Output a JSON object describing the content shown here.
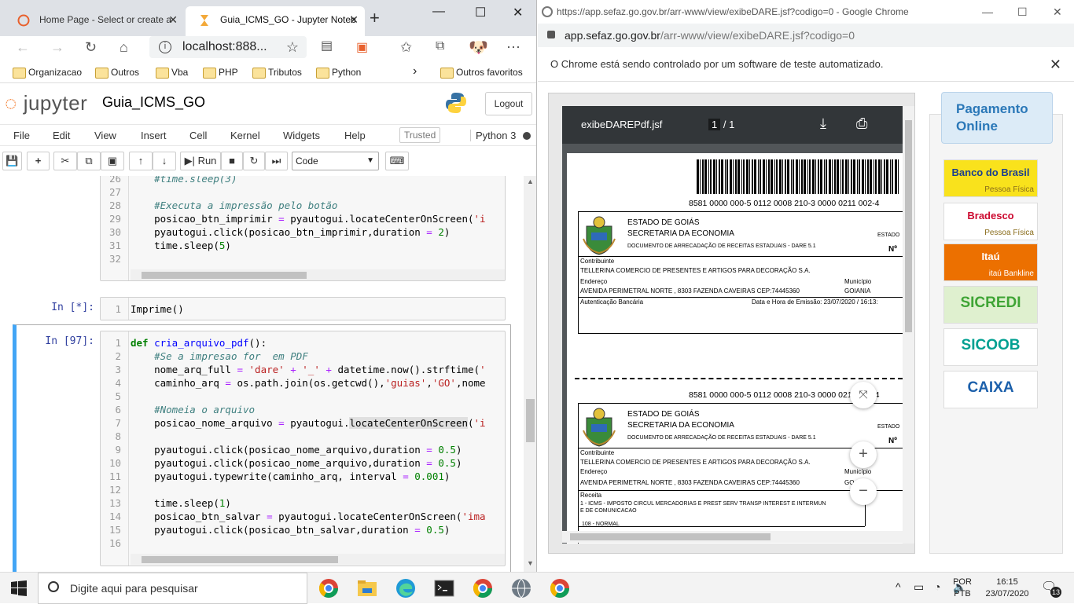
{
  "edge": {
    "tabs": [
      {
        "label": "Home Page - Select or create a"
      },
      {
        "label": "Guia_ICMS_GO - Jupyter Noteb"
      }
    ],
    "address": "localhost:888...",
    "favorites": [
      "Organizacao",
      "Outros",
      "Vba",
      "PHP",
      "Tributos",
      "Python"
    ],
    "other_favorites": "Outros favoritos"
  },
  "jupyter": {
    "logo": "jupyter",
    "notebook_name": "Guia_ICMS_GO",
    "logout": "Logout",
    "menu": [
      "File",
      "Edit",
      "View",
      "Insert",
      "Cell",
      "Kernel",
      "Widgets",
      "Help"
    ],
    "trusted": "Trusted",
    "kernel": "Python 3",
    "run_label": "Run",
    "cell_type": "Code",
    "cells": [
      {
        "prompt": "",
        "line_start": 26,
        "lines": [
          "    #time.sleep(3)",
          "",
          "    #Executa a impressão pelo botão",
          "    posicao_btn_imprimir = pyautogui.locateCenterOnScreen('i",
          "    pyautogui.click(posicao_btn_imprimir,duration = 2)",
          "    time.sleep(5)",
          ""
        ]
      },
      {
        "prompt": "In [*]:",
        "line_start": 1,
        "lines": [
          "Imprime()"
        ]
      },
      {
        "prompt": "In [97]:",
        "line_start": 1,
        "lines": [
          "def cria_arquivo_pdf():",
          "    #Se a impresao for  em PDF",
          "    nome_arq_full = 'dare' + '_' + datetime.now().strftime('",
          "    caminho_arq = os.path.join(os.getcwd(),'guias','GO',nome",
          "",
          "    #Nomeia o arquivo",
          "    posicao_nome_arquivo = pyautogui.locateCenterOnScreen('i",
          "",
          "    pyautogui.click(posicao_nome_arquivo,duration = 0.5)",
          "    pyautogui.click(posicao_nome_arquivo,duration = 0.5)",
          "    pyautogui.typewrite(caminho_arq, interval = 0.001)",
          "",
          "    time.sleep(1)",
          "    posicao_btn_salvar = pyautogui.locateCenterOnScreen('ima",
          "    pyautogui.click(posicao_btn_salvar,duration = 0.5)",
          ""
        ]
      }
    ]
  },
  "chrome": {
    "title": "https://app.sefaz.go.gov.br/arr-www/view/exibeDARE.jsf?codigo=0 - Google Chrome",
    "address_host": "app.sefaz.go.gov.br",
    "address_path": "/arr-www/view/exibeDARE.jsf?codigo=0",
    "infobar": "O Chrome está sendo controlado por um software de teste automatizado.",
    "pdf": {
      "filename": "exibeDAREPdf.jsf",
      "page_current": "1",
      "page_total": "/ 1",
      "barcode_number": "8581 0000 000-5  0112 0008 210-3  0000 0211 002-4",
      "state": "ESTADO DE GOIÁS",
      "secretaria": "SECRETARIA DA ECONOMIA",
      "doc_title": "DOCUMENTO DE ARRECADAÇÃO DE RECEITAS ESTADUAIS - DARE 5.1",
      "estado_label": "ESTADO",
      "no_label": "Nº",
      "contribuinte_label": "Contribuinte",
      "contribuinte": "TELLERINA COMERCIO DE PRESENTES E ARTIGOS PARA DECORAÇÃO S.A.",
      "endereco_label": "Endereço",
      "municipio_label": "Município",
      "endereco": "AVENIDA PERIMETRAL NORTE , 8303 FAZENDA CAVEIRAS  CEP:74445360",
      "municipio": "GOIANIA",
      "municipio_cut": "GO",
      "autenticacao": "Autenticação Bancária",
      "emissao": "Data e Hora de Emissão: 23/07/2020 / 16:13:",
      "receita_label": "Receita",
      "receita": "1 - ICMS - IMPOSTO CIRCUL MERCADORIAS E PREST SERV TRANSP INTEREST E INTERMUN",
      "receita2": "E DE COMUNICACAO",
      "receita_code": "108 - NORMAL"
    },
    "payment_title": "Pagamento Online",
    "banks": [
      {
        "name": "Banco do Brasil",
        "sub": "Pessoa Física",
        "bg": "#f9e21c",
        "fg": "#1a3f8f"
      },
      {
        "name": "Bradesco",
        "sub": "Pessoa Física",
        "bg": "#ffffff",
        "fg": "#cc092f"
      },
      {
        "name": "Itaú",
        "sub": "itaú Bankline",
        "bg": "#ec7000",
        "fg": "#ffffff"
      },
      {
        "name": "SICREDI",
        "sub": "",
        "bg": "#dff0cf",
        "fg": "#3fa435"
      },
      {
        "name": "SICOOB",
        "sub": "",
        "bg": "#ffffff",
        "fg": "#00a091"
      },
      {
        "name": "CAIXA",
        "sub": "",
        "bg": "#ffffff",
        "fg": "#1c60ab"
      }
    ]
  },
  "taskbar": {
    "search_placeholder": "Digite aqui para pesquisar",
    "lang1": "POR",
    "lang2": "PTB",
    "time": "16:15",
    "date": "23/07/2020",
    "notifications": "13"
  }
}
